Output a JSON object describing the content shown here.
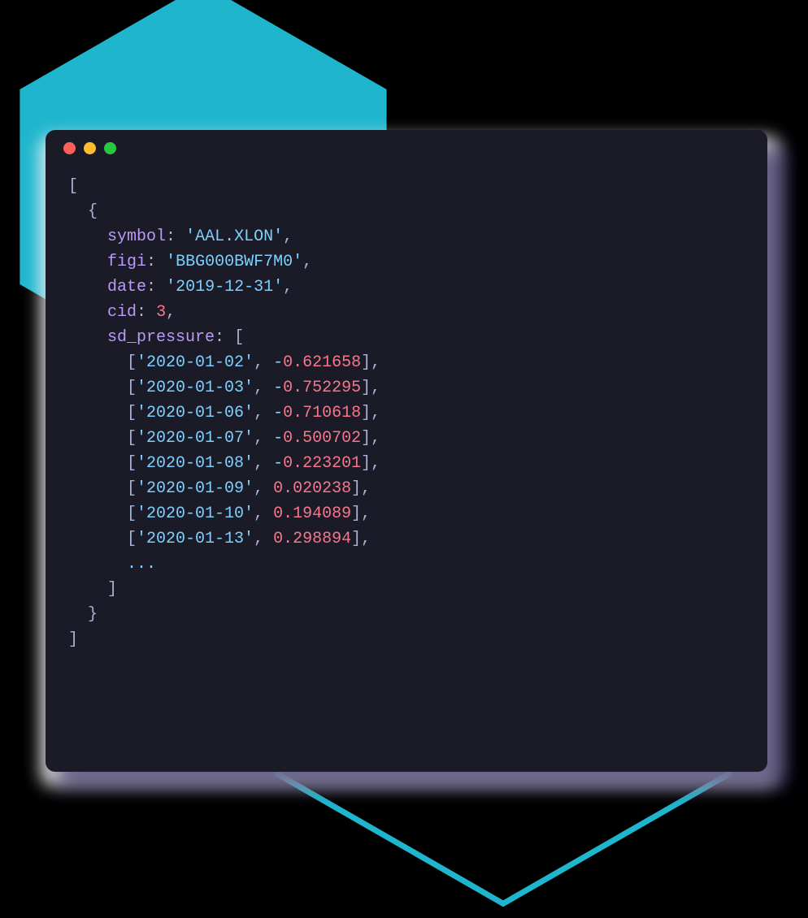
{
  "code": {
    "keys": {
      "symbol": "symbol",
      "figi": "figi",
      "date": "date",
      "cid": "cid",
      "sd_pressure": "sd_pressure"
    },
    "values": {
      "symbol": "'AAL.XLON'",
      "figi": "'BBG000BWF7M0'",
      "date": "'2019-12-31'",
      "cid": "3"
    },
    "sd_pressure": [
      {
        "date": "'2020-01-02'",
        "val": "-0.621658"
      },
      {
        "date": "'2020-01-03'",
        "val": "-0.752295"
      },
      {
        "date": "'2020-01-06'",
        "val": "-0.710618"
      },
      {
        "date": "'2020-01-07'",
        "val": "-0.500702"
      },
      {
        "date": "'2020-01-08'",
        "val": "-0.223201"
      },
      {
        "date": "'2020-01-09'",
        "val": "0.020238"
      },
      {
        "date": "'2020-01-10'",
        "val": "0.194089"
      },
      {
        "date": "'2020-01-13'",
        "val": "0.298894"
      }
    ],
    "ellipsis": "..."
  },
  "colors": {
    "accent": "#1fb6cd",
    "terminal_bg": "#1a1b26"
  }
}
